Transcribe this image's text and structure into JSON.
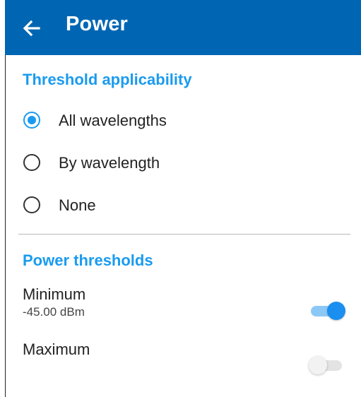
{
  "appbar": {
    "title": "Power",
    "back_icon": "arrow-left-icon",
    "color": "#0066b3"
  },
  "accent_color": "#1a9bef",
  "threshold_applicability": {
    "title": "Threshold applicability",
    "options": [
      {
        "label": "All wavelengths",
        "selected": true
      },
      {
        "label": "By wavelength",
        "selected": false
      },
      {
        "label": "None",
        "selected": false
      }
    ]
  },
  "power_thresholds": {
    "title": "Power thresholds",
    "minimum": {
      "label": "Minimum",
      "value": "-45.00 dBm",
      "enabled": true
    },
    "maximum": {
      "label": "Maximum",
      "enabled": false
    }
  }
}
